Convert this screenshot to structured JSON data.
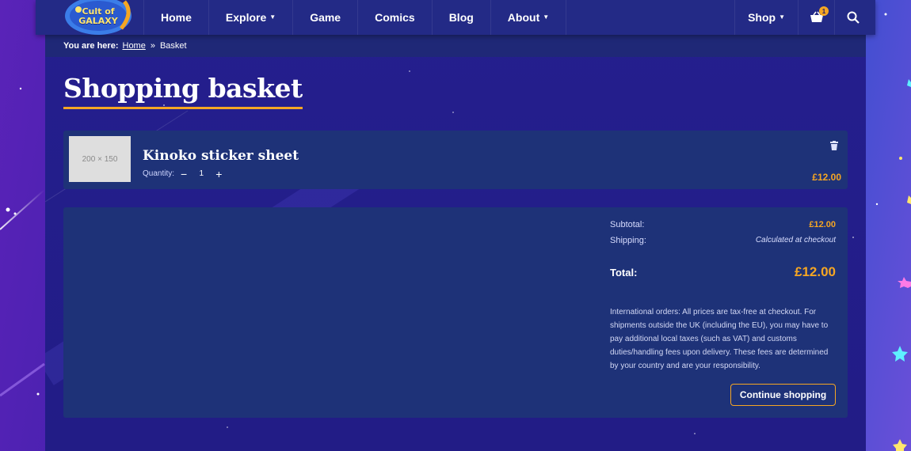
{
  "header": {
    "logo_text": "Cult of GALAXY",
    "nav": [
      {
        "label": "Home",
        "has_dropdown": false
      },
      {
        "label": "Explore",
        "has_dropdown": true
      },
      {
        "label": "Game",
        "has_dropdown": false
      },
      {
        "label": "Comics",
        "has_dropdown": false
      },
      {
        "label": "Blog",
        "has_dropdown": false
      },
      {
        "label": "About",
        "has_dropdown": true
      }
    ],
    "shop_label": "Shop",
    "cart_count": "1",
    "cart_icon": "basket-icon",
    "search_icon": "search-icon"
  },
  "breadcrumb": {
    "lead": "You are here:",
    "home": "Home",
    "separator": "»",
    "current": "Basket"
  },
  "page_title": "Shopping basket",
  "item": {
    "thumb_text": "200 × 150",
    "name": "Kinoko sticker sheet",
    "quantity_label": "Quantity:",
    "minus": "−",
    "quantity": "1",
    "plus": "+",
    "price": "£12.00"
  },
  "summary": {
    "subtotal_label": "Subtotal:",
    "subtotal_value": "£12.00",
    "shipping_label": "Shipping:",
    "shipping_value": "Calculated at checkout",
    "total_label": "Total:",
    "total_value": "£12.00",
    "international_note": "International orders: All prices are tax-free at checkout. For shipments outside the UK (including the EU), you may have to pay additional local taxes (such as VAT) and customs duties/handling fees upon delivery. These fees are determined by your country and are your responsibility.",
    "continue_label": "Continue shopping"
  },
  "colors": {
    "accent": "#f5a623",
    "header_bg": "#232a86",
    "card_bg": "#1e3278",
    "page_bg": "#241f8e"
  }
}
